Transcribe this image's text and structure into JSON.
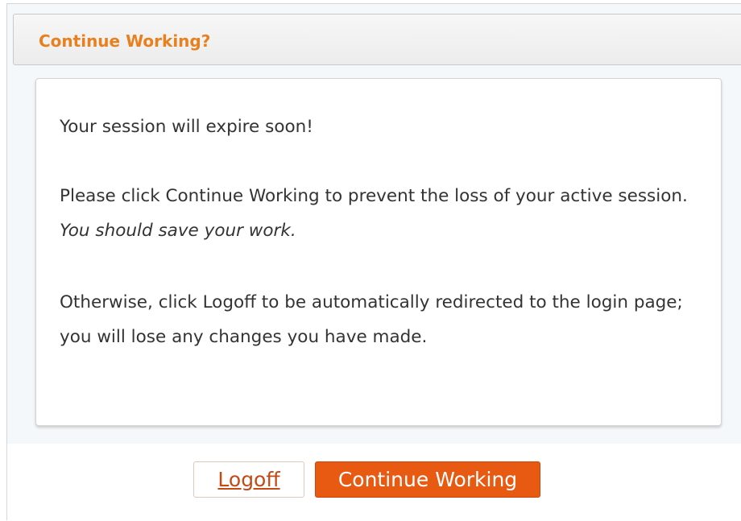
{
  "dialog": {
    "title": "Continue Working?",
    "message": {
      "line1": "Your session will expire soon!",
      "line2_main": "Please click Continue Working to prevent the loss of your active session.",
      "line2_emphasis": "You should save your work.",
      "line3": "Otherwise, click Logoff to be automatically redirected to the login page; you will lose any changes you have made."
    },
    "buttons": {
      "logoff_label": "Logoff",
      "continue_label": "Continue Working"
    }
  },
  "colors": {
    "title_accent": "#e8801f",
    "primary_button": "#e85a12",
    "logoff_text": "#c44a14"
  }
}
